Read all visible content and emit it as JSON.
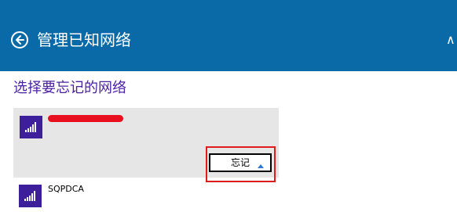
{
  "header": {
    "title": "管理已知网络",
    "back_icon": "back-arrow-icon",
    "edge_glyph": "∧",
    "background": "#0a6aa8"
  },
  "section": {
    "title": "选择要忘记的网络",
    "title_color": "#4b1fa3"
  },
  "networks": [
    {
      "name": "",
      "name_redacted": true,
      "selected": true,
      "icon": "wifi-signal-icon",
      "forget_label": "忘记"
    },
    {
      "name": "SQPDCA",
      "selected": false,
      "icon": "wifi-signal-icon"
    }
  ],
  "colors": {
    "accent": "#3d1f9c",
    "highlight": "#e01b1b",
    "redaction": "#e8101e"
  }
}
